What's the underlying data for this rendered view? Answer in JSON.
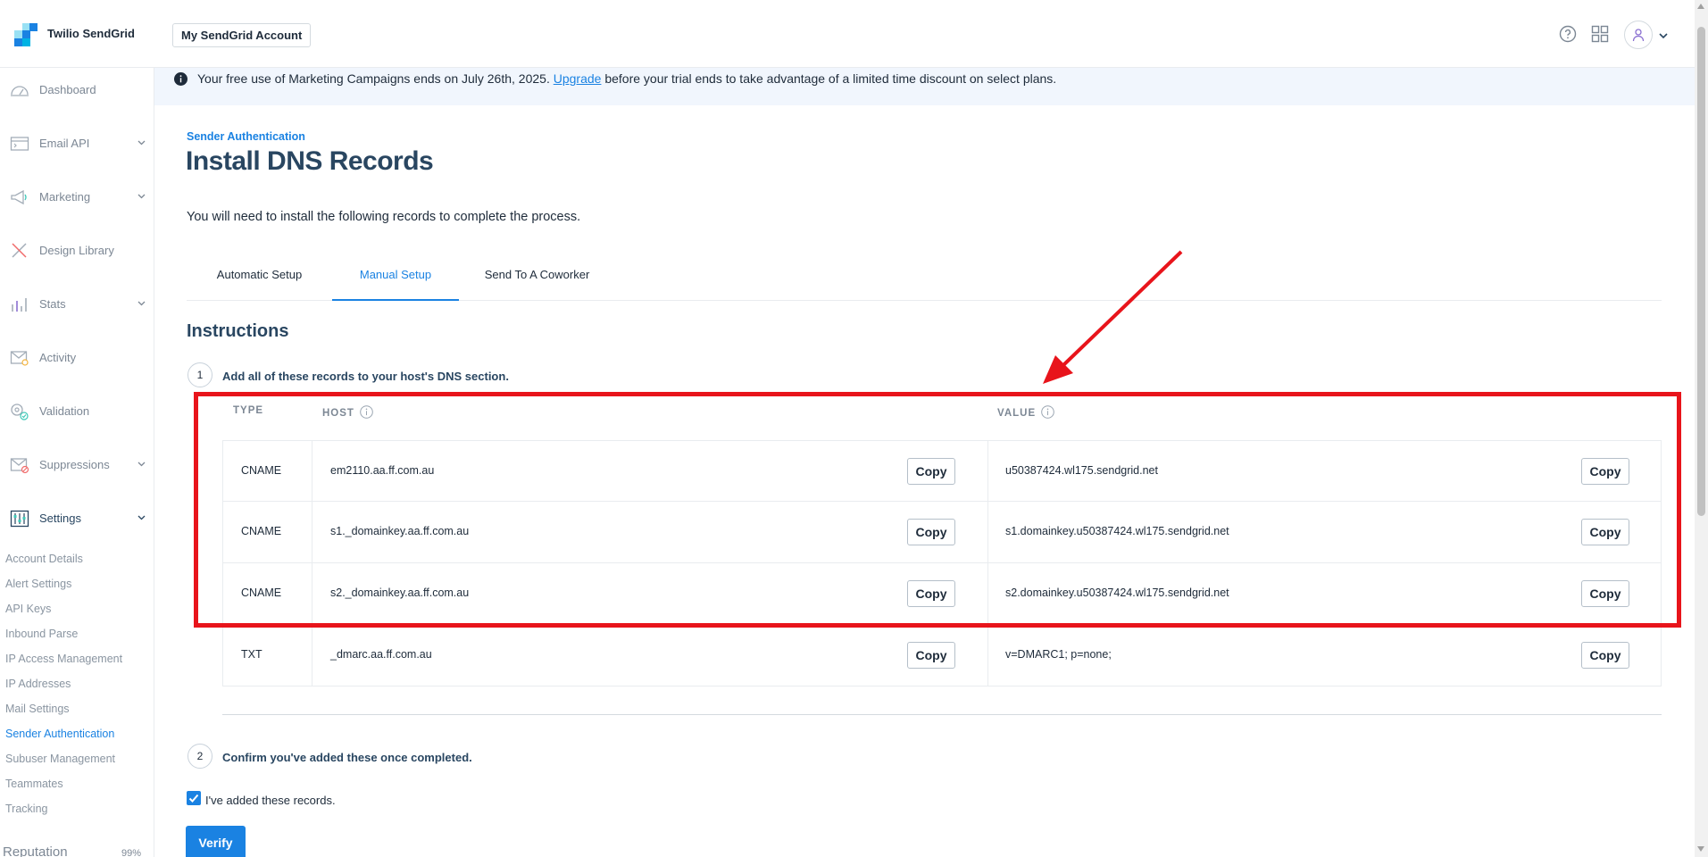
{
  "header": {
    "brand": "Twilio SendGrid",
    "account_button": "My SendGrid Account",
    "icons": [
      "help-icon",
      "apps-grid-icon",
      "user-icon",
      "chevron-down-icon"
    ]
  },
  "sidebar": {
    "items": [
      {
        "label": "Dashboard",
        "icon": "dashboard-icon"
      },
      {
        "label": "Email API",
        "icon": "email-api-icon",
        "expandable": true
      },
      {
        "label": "Marketing",
        "icon": "megaphone-icon",
        "expandable": true
      },
      {
        "label": "Design Library",
        "icon": "design-icon"
      },
      {
        "label": "Stats",
        "icon": "stats-icon",
        "expandable": true
      },
      {
        "label": "Activity",
        "icon": "activity-icon"
      },
      {
        "label": "Validation",
        "icon": "validation-icon"
      },
      {
        "label": "Suppressions",
        "icon": "suppressions-icon",
        "expandable": true
      },
      {
        "label": "Settings",
        "icon": "settings-icon",
        "expandable": true,
        "expanded": true
      }
    ],
    "settings_sub": [
      "Account Details",
      "Alert Settings",
      "API Keys",
      "Inbound Parse",
      "IP Access Management",
      "IP Addresses",
      "Mail Settings",
      "Sender Authentication",
      "Subuser Management",
      "Teammates",
      "Tracking"
    ],
    "active_sub": "Sender Authentication",
    "reputation_label": "Reputation",
    "reputation_value": "99%"
  },
  "banner": {
    "text_before": "Your free use of Marketing Campaigns ends on July 26th, 2025.",
    "link": "Upgrade",
    "text_after": "before your trial ends to take advantage of a limited time discount on select plans."
  },
  "page": {
    "breadcrumb": "Sender Authentication",
    "title": "Install DNS Records",
    "intro": "You will need to install the following records to complete the process."
  },
  "tabs": [
    {
      "label": "Automatic Setup",
      "active": false
    },
    {
      "label": "Manual Setup",
      "active": true
    },
    {
      "label": "Send To A Coworker",
      "active": false
    }
  ],
  "instructions": {
    "heading": "Instructions",
    "step1_number": "1",
    "step1_text": "Add all of these records to your host's DNS section.",
    "step2_number": "2",
    "step2_text": "Confirm you've added these once completed."
  },
  "dns_table": {
    "headers": {
      "type": "TYPE",
      "host": "HOST",
      "value": "VALUE"
    },
    "copy_label": "Copy",
    "rows": [
      {
        "type": "CNAME",
        "host": "em2110.aa.ff.com.au",
        "value": "u50387424.wl175.sendgrid.net"
      },
      {
        "type": "CNAME",
        "host": "s1._domainkey.aa.ff.com.au",
        "value": "s1.domainkey.u50387424.wl175.sendgrid.net"
      },
      {
        "type": "CNAME",
        "host": "s2._domainkey.aa.ff.com.au",
        "value": "s2.domainkey.u50387424.wl175.sendgrid.net"
      },
      {
        "type": "TXT",
        "host": "_dmarc.aa.ff.com.au",
        "value": "v=DMARC1; p=none;"
      }
    ]
  },
  "confirm": {
    "checkbox_label": "I've added these records.",
    "checked": true,
    "verify_label": "Verify"
  },
  "colors": {
    "accent": "#1a82e2",
    "annotation": "#e8141b",
    "text": "#294661",
    "banner_bg": "#f1f6fd"
  }
}
